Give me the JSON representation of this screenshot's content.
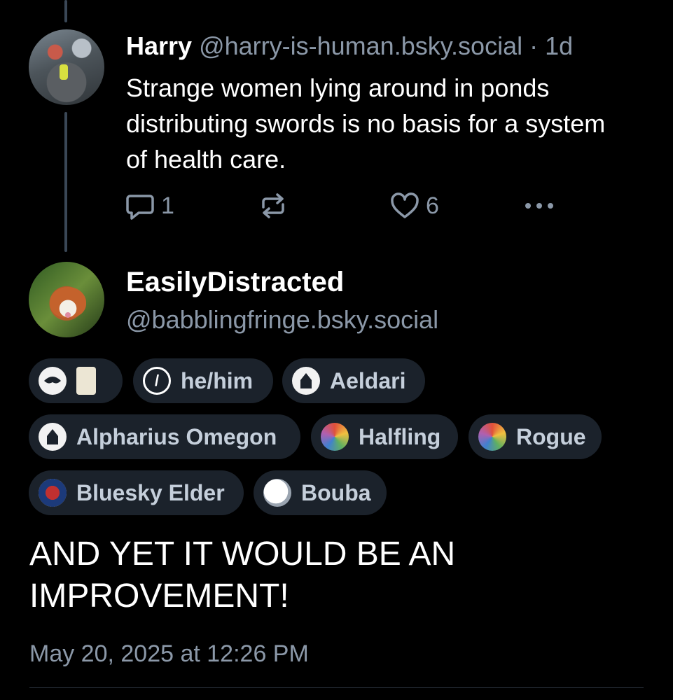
{
  "parent_post": {
    "author_name": "Harry",
    "handle": "@harry-is-human.bsky.social",
    "separator": "·",
    "age": "1d",
    "text": "Strange women lying around in ponds distributing swords is no basis for a system of health care.",
    "reply_count": "1",
    "like_count": "6",
    "icons": {
      "reply": "reply-icon",
      "repost": "repost-icon",
      "like": "heart-icon",
      "more": "more-options-icon"
    }
  },
  "reply_post": {
    "author_name": "EasilyDistracted",
    "handle": "@babblingfringe.bsky.social",
    "labels": [
      {
        "icon": "mask-icon",
        "text": ""
      },
      {
        "icon": "slash-icon",
        "text": "he/him"
      },
      {
        "icon": "aeldari-icon",
        "text": "Aeldari"
      },
      {
        "icon": "alpharius-icon",
        "text": "Alpharius Omegon"
      },
      {
        "icon": "halfling-icon",
        "text": "Halfling"
      },
      {
        "icon": "rogue-icon",
        "text": "Rogue"
      },
      {
        "icon": "bluesky-elder-icon",
        "text": "Bluesky Elder"
      },
      {
        "icon": "bouba-icon",
        "text": "Bouba"
      }
    ],
    "text": "AND YET IT WOULD BE AN IMPROVEMENT!",
    "timestamp": "May 20, 2025 at 12:26 PM"
  },
  "colors": {
    "background": "#000000",
    "text": "#ffffff",
    "muted": "#8b98a8",
    "pill": "#1b222b",
    "thread_line": "#3a4756"
  }
}
